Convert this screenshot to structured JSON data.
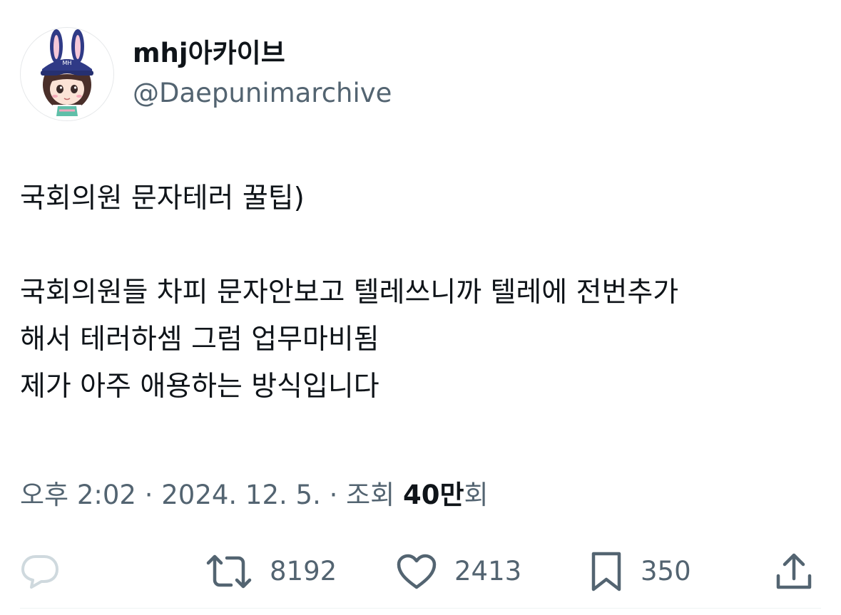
{
  "author": {
    "display_name": "mhj아카이브",
    "handle": "@Daepunimarchive",
    "avatar_icon": "bunny-ear-cap-character-avatar",
    "avatar_badge": "MH"
  },
  "tweet": {
    "lines": [
      "국회의원 문자테러 꿀팁)",
      "",
      "국회의원들 차피 문자안보고 텔레쓰니까 텔레에 전번추가",
      "해서 테러하셈 그럼 업무마비됨",
      "제가 아주 애용하는 방식입니다"
    ]
  },
  "meta": {
    "time": "오후 2:02",
    "separator": " · ",
    "date": "2024. 12. 5.",
    "views_label": "조회 ",
    "views_count": "40만",
    "views_suffix": "회"
  },
  "actions": {
    "reply": {
      "icon": "reply-bubble-icon",
      "count": ""
    },
    "retweet": {
      "icon": "retweet-icon",
      "count": "8192"
    },
    "like": {
      "icon": "heart-icon",
      "count": "2413"
    },
    "bookmark": {
      "icon": "bookmark-icon",
      "count": "350"
    },
    "share": {
      "icon": "share-icon"
    }
  },
  "colors": {
    "text_primary": "#0f1419",
    "text_secondary": "#536471",
    "reply_icon_faded": "#cfd9de"
  }
}
